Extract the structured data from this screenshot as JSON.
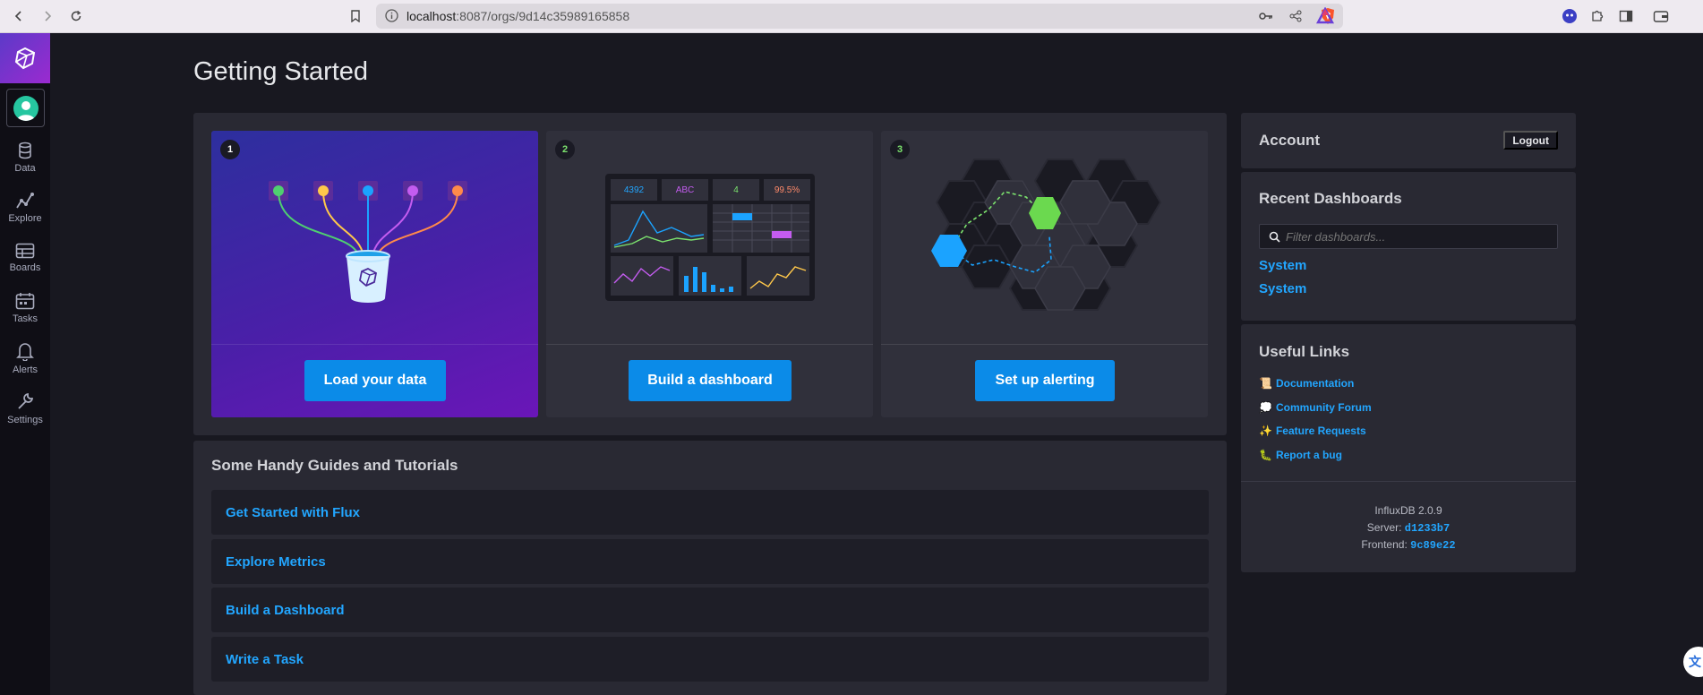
{
  "browser": {
    "url_host": "localhost",
    "url_rest": ":8087/orgs/9d14c35989165858"
  },
  "sidebar": {
    "items": [
      {
        "label": "Data",
        "icon": "database-icon"
      },
      {
        "label": "Explore",
        "icon": "explore-graph-icon"
      },
      {
        "label": "Boards",
        "icon": "boards-grid-icon"
      },
      {
        "label": "Tasks",
        "icon": "calendar-icon"
      },
      {
        "label": "Alerts",
        "icon": "bell-icon"
      },
      {
        "label": "Settings",
        "icon": "wrench-icon"
      }
    ]
  },
  "main": {
    "title": "Getting Started",
    "steps": [
      {
        "number": "1",
        "button": "Load your data"
      },
      {
        "number": "2",
        "button": "Build a dashboard"
      },
      {
        "number": "3",
        "button": "Set up alerting"
      }
    ],
    "dashboard_illustration": {
      "stat1": "4392",
      "stat2": "ABC",
      "stat3": "4",
      "stat4": "99.5%"
    },
    "guides": {
      "title": "Some Handy Guides and Tutorials",
      "items": [
        "Get Started with Flux",
        "Explore Metrics",
        "Build a Dashboard",
        "Write a Task"
      ]
    }
  },
  "right": {
    "account": {
      "title": "Account",
      "logout": "Logout"
    },
    "recent": {
      "title": "Recent Dashboards",
      "filter_placeholder": "Filter dashboards...",
      "items": [
        "System",
        "System"
      ]
    },
    "useful": {
      "title": "Useful Links",
      "links": [
        {
          "emoji": "📜",
          "label": "Documentation"
        },
        {
          "emoji": "💭",
          "label": "Community Forum"
        },
        {
          "emoji": "✨",
          "label": "Feature Requests"
        },
        {
          "emoji": "🐛",
          "label": "Report a bug"
        }
      ],
      "version": "InfluxDB 2.0.9",
      "server_label": "Server:",
      "server_hash": "d1233b7",
      "frontend_label": "Frontend:",
      "frontend_hash": "9c89e22"
    }
  },
  "colors": {
    "accent": "#22a6ff",
    "button": "#0b8be8",
    "background": "#181820",
    "panel": "#292933"
  }
}
